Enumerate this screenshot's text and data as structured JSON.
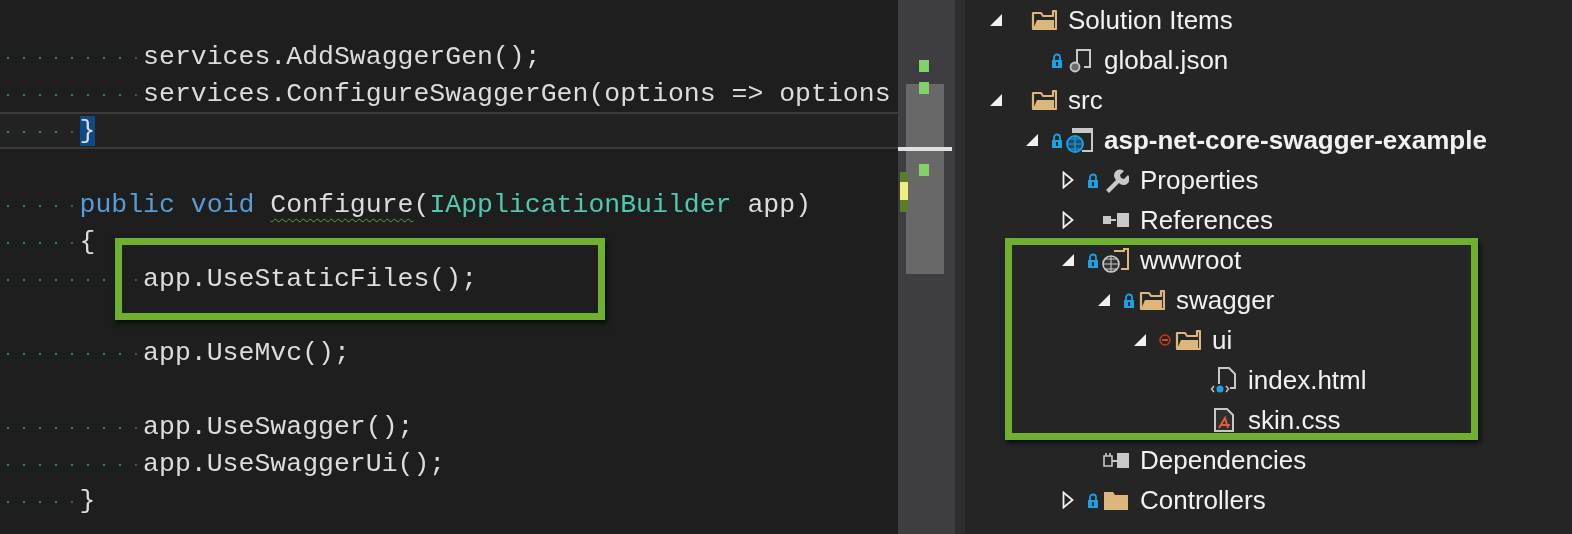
{
  "editor": {
    "lines": [
      {
        "kind": "statement",
        "current": false,
        "highlighted": false,
        "tokens": [
          {
            "text": "services.AddSwaggerGen();",
            "kind": "plain"
          }
        ]
      },
      {
        "kind": "statement",
        "current": false,
        "highlighted": false,
        "tokens": [
          {
            "text": "services.ConfigureSwaggerGen(options => options",
            "kind": "plain"
          }
        ]
      },
      {
        "kind": "member",
        "current": true,
        "highlighted": false,
        "tokens": [
          {
            "text": "}",
            "kind": "brace-match"
          }
        ]
      },
      {
        "kind": "blank"
      },
      {
        "kind": "member",
        "current": false,
        "highlighted": false,
        "tokens": [
          {
            "text": "public void ",
            "kind": "keyword"
          },
          {
            "text": "Configure",
            "kind": "squiggle"
          },
          {
            "text": "(",
            "kind": "plain"
          },
          {
            "text": "IApplicationBuilder",
            "kind": "type"
          },
          {
            "text": " app)",
            "kind": "plain"
          }
        ]
      },
      {
        "kind": "member",
        "current": false,
        "highlighted": false,
        "tokens": [
          {
            "text": "{",
            "kind": "plain"
          }
        ]
      },
      {
        "kind": "statement",
        "current": false,
        "highlighted": true,
        "tokens": [
          {
            "text": "app.UseStaticFiles();",
            "kind": "plain"
          }
        ]
      },
      {
        "kind": "blank"
      },
      {
        "kind": "statement",
        "current": false,
        "highlighted": false,
        "tokens": [
          {
            "text": "app.UseMvc();",
            "kind": "plain"
          }
        ]
      },
      {
        "kind": "blank"
      },
      {
        "kind": "statement",
        "current": false,
        "highlighted": false,
        "tokens": [
          {
            "text": "app.UseSwagger();",
            "kind": "plain"
          }
        ]
      },
      {
        "kind": "statement",
        "current": false,
        "highlighted": false,
        "tokens": [
          {
            "text": "app.UseSwaggerUi();",
            "kind": "plain"
          }
        ]
      },
      {
        "kind": "member",
        "current": false,
        "highlighted": false,
        "tokens": [
          {
            "text": "}",
            "kind": "plain"
          }
        ]
      }
    ]
  },
  "solution_explorer": {
    "tree": [
      {
        "label": "Solution Items",
        "kind": "folder",
        "expanded": true,
        "children": [
          {
            "label": "global.json",
            "kind": "json-file",
            "locked": true
          }
        ]
      },
      {
        "label": "src",
        "kind": "folder",
        "expanded": true,
        "children": [
          {
            "label": "asp-net-core-swagger-example",
            "kind": "web-project",
            "locked": true,
            "startup": true,
            "expanded": true,
            "children": [
              {
                "label": "Properties",
                "kind": "properties",
                "locked": true,
                "expanded": false
              },
              {
                "label": "References",
                "kind": "references",
                "expanded": false
              },
              {
                "label": "wwwroot",
                "kind": "web-folder",
                "locked": true,
                "expanded": true,
                "highlighted": true,
                "children": [
                  {
                    "label": "swagger",
                    "kind": "folder",
                    "locked": true,
                    "expanded": true,
                    "children": [
                      {
                        "label": "ui",
                        "kind": "folder",
                        "excluded": true,
                        "expanded": true,
                        "children": [
                          {
                            "label": "index.html",
                            "kind": "html-file"
                          },
                          {
                            "label": "skin.css",
                            "kind": "css-file"
                          }
                        ]
                      }
                    ]
                  }
                ]
              },
              {
                "label": "Dependencies",
                "kind": "dependencies"
              },
              {
                "label": "Controllers",
                "kind": "folder",
                "locked": true,
                "expanded": false
              }
            ]
          }
        ]
      }
    ]
  }
}
